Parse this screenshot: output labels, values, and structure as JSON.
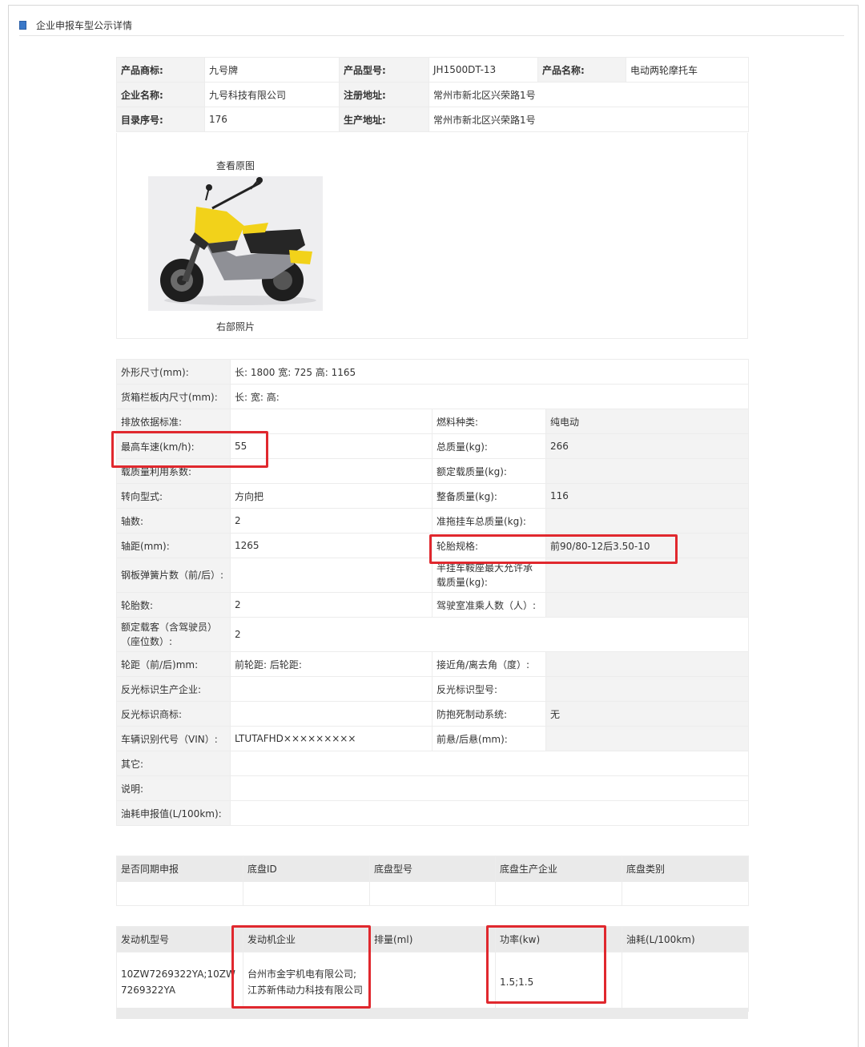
{
  "page": {
    "title": "企业申报车型公示详情"
  },
  "product": {
    "brand_label": "产品商标:",
    "brand": "九号牌",
    "model_label": "产品型号:",
    "model": "JH1500DT-13",
    "name_label": "产品名称:",
    "name": "电动两轮摩托车",
    "company_label": "企业名称:",
    "company": "九号科技有限公司",
    "reg_addr_label": "注册地址:",
    "reg_addr": "常州市新北区兴荣路1号",
    "catalog_label": "目录序号:",
    "catalog": "176",
    "prod_addr_label": "生产地址:",
    "prod_addr": "常州市新北区兴荣路1号"
  },
  "photo": {
    "view_original": "查看原图",
    "caption": "右部照片",
    "body_color": "#f2d21a"
  },
  "specs": {
    "dim_label": "外形尺寸(mm):",
    "dim": "长: 1800 宽: 725 高: 1165",
    "cargo_label": "货箱栏板内尺寸(mm):",
    "cargo": "长:  宽:  高:",
    "emission_label": "排放依据标准:",
    "emission": "",
    "fuel_label": "燃料种类:",
    "fuel": "纯电动",
    "speed_label": "最高车速(km/h):",
    "speed": "55",
    "gross_label": "总质量(kg):",
    "gross": "266",
    "load_coef_label": "载质量利用系数:",
    "load_coef": "",
    "rated_load_label": "额定载质量(kg):",
    "rated_load": "",
    "steering_label": "转向型式:",
    "steering": "方向把",
    "curb_label": "整备质量(kg):",
    "curb": "116",
    "axles_label": "轴数:",
    "axles": "2",
    "trailer_label": "准拖挂车总质量(kg):",
    "trailer": "",
    "wheelbase_label": "轴距(mm):",
    "wheelbase": "1265",
    "tire_label": "轮胎规格:",
    "tire": "前90/80-12后3.50-10",
    "spring_label": "钢板弹簧片数（前/后）:",
    "spring": "",
    "saddle_label": "半挂车鞍座最大允许承载质量(kg):",
    "saddle": "",
    "tires_label": "轮胎数:",
    "tires": "2",
    "cab_label": "驾驶室准乘人数（人）:",
    "cab": "",
    "seats_label": "额定载客（含驾驶员）（座位数）:",
    "seats": "2",
    "track_label": "轮距（前/后)mm:",
    "track": "前轮距: 后轮距:",
    "angle_label": "接近角/离去角（度）:",
    "angle": "",
    "reflect_maker_label": "反光标识生产企业:",
    "reflect_maker": "",
    "reflect_model_label": "反光标识型号:",
    "reflect_model": "",
    "reflect_brand_label": "反光标识商标:",
    "reflect_brand": "",
    "abs_label": "防抱死制动系统:",
    "abs": "无",
    "vin_label": "车辆识别代号（VIN）:",
    "vin": "LTUTAFHD×××××××××",
    "overhang_label": "前悬/后悬(mm):",
    "overhang": "",
    "other_label": "其它:",
    "other": "",
    "note_label": "说明:",
    "note": "",
    "consumption_label": "油耗申报值(L/100km):",
    "consumption": ""
  },
  "chassis": {
    "headers": [
      "是否同期申报",
      "底盘ID",
      "底盘型号",
      "底盘生产企业",
      "底盘类别"
    ],
    "row": [
      "",
      "",
      "",
      "",
      ""
    ]
  },
  "engine": {
    "headers": [
      "发动机型号",
      "发动机企业",
      "排量(ml)",
      "功率(kw)",
      "油耗(L/100km)"
    ],
    "row": [
      "10ZW7269322YA;10ZW7269322YA",
      "台州市金宇机电有限公司;江苏新伟动力科技有限公司",
      "",
      "1.5;1.5",
      ""
    ]
  },
  "colors": {
    "highlight": "#e0282e",
    "label_bg": "#f3f3f3",
    "header_bg": "#eaeaea"
  }
}
